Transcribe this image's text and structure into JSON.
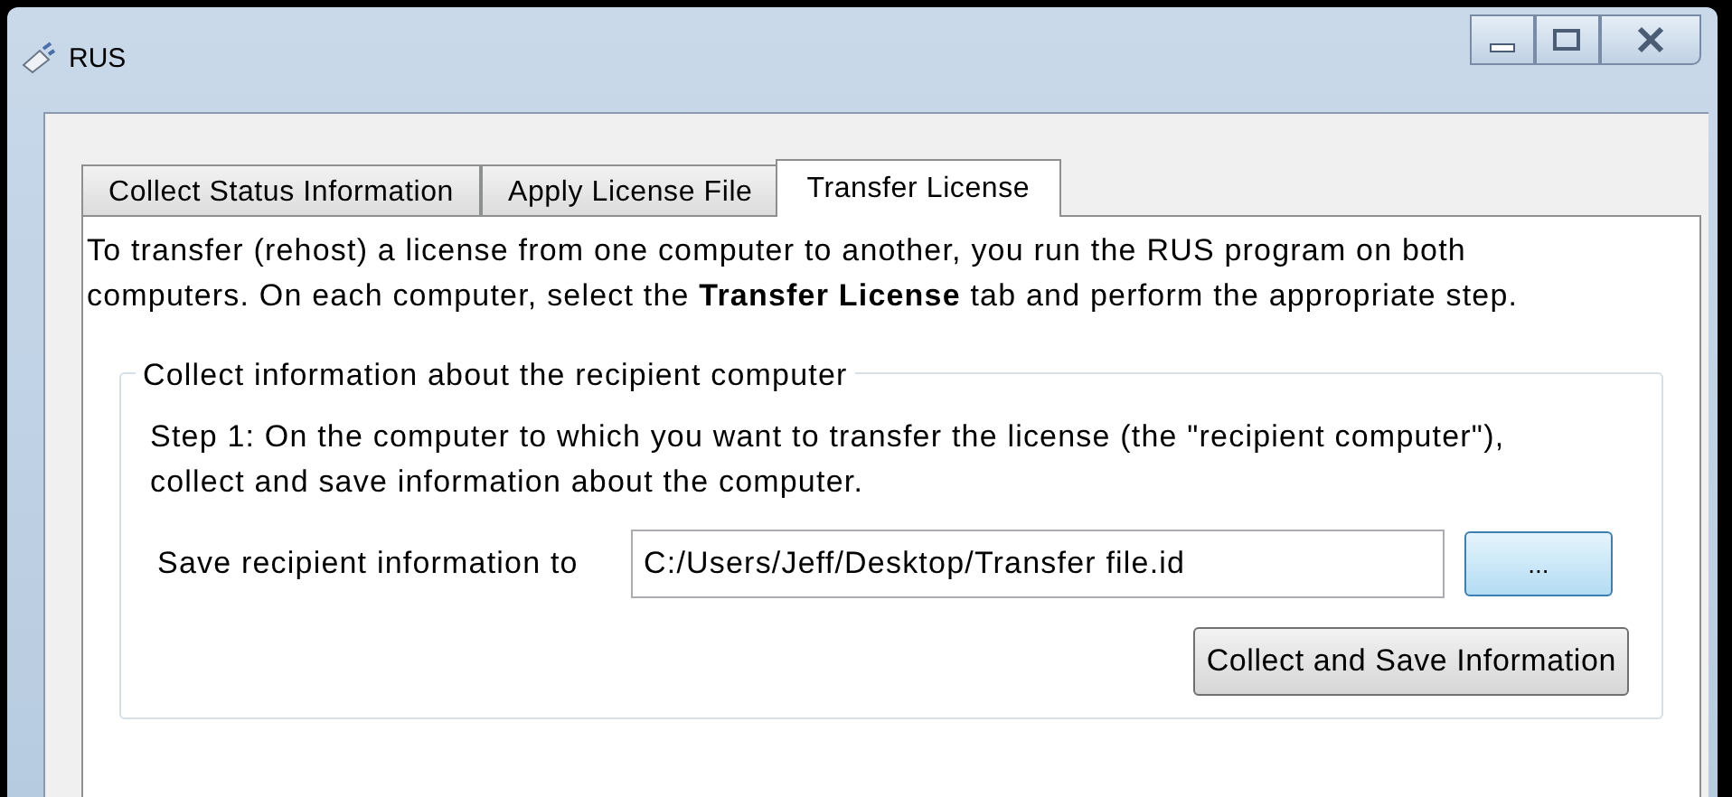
{
  "window": {
    "title": "RUS"
  },
  "title_buttons": [
    {
      "kind": "minimize"
    },
    {
      "kind": "maximize"
    },
    {
      "kind": "close"
    }
  ],
  "tabs": [
    {
      "label": "Collect Status Information",
      "selected": false
    },
    {
      "label": "Apply License File",
      "selected": false
    },
    {
      "label": "Transfer License",
      "selected": true
    }
  ],
  "intro": "To transfer (rehost) a license from one computer to another, you run the RUS program on both computers. On each computer, select the **Transfer License** tab and perform the appropriate step.",
  "group": {
    "title": "Collect information about the recipient computer",
    "step": "Step 1: On the computer to which you want to transfer the license (the \"recipient computer\"), collect and save information about the computer.",
    "field_label": "Save recipient information to",
    "field_value": "C:/Users/Jeff/Desktop/Transfer file.id",
    "browse_button": "...",
    "action_button": "Collect and Save Information"
  }
}
